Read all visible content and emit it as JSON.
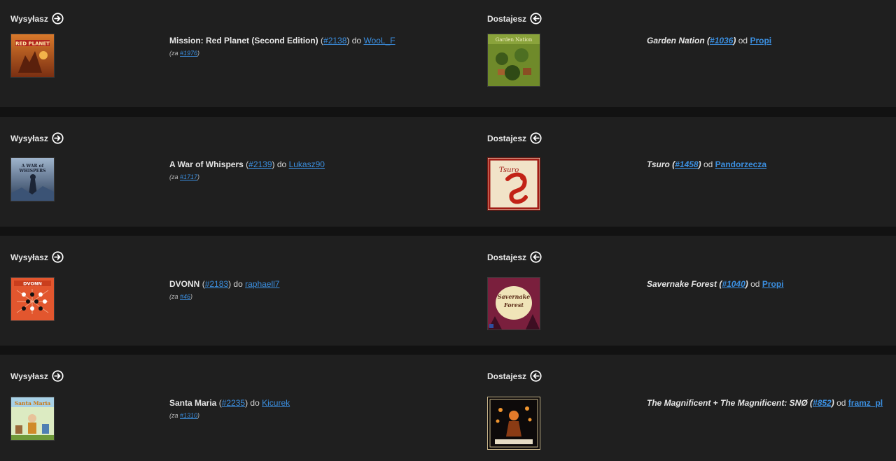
{
  "labels": {
    "send": "Wysyłasz",
    "receive": "Dostajesz",
    "to": "do",
    "from": "od",
    "za_prefix": "(za ",
    "za_suffix": ")"
  },
  "trades": [
    {
      "send": {
        "title": "Mission: Red Planet (Second Edition)",
        "id": "#2138",
        "user": "WooL_F",
        "za": "#1976"
      },
      "receive": {
        "title": "Garden Nation",
        "id": "#1036",
        "user": "Propi"
      }
    },
    {
      "send": {
        "title": "A War of Whispers",
        "id": "#2139",
        "user": "Lukasz90",
        "za": "#1717"
      },
      "receive": {
        "title": "Tsuro",
        "id": "#1458",
        "user": "Pandorzecza"
      }
    },
    {
      "send": {
        "title": "DVONN",
        "id": "#2183",
        "user": "raphaell7",
        "za": "#46"
      },
      "receive": {
        "title": "Savernake Forest",
        "id": "#1040",
        "user": "Propi"
      }
    },
    {
      "send": {
        "title": "Santa Maria",
        "id": "#2235",
        "user": "Kicurek",
        "za": "#1310"
      },
      "receive": {
        "title": "The Magnificent + The Magnificent: SNØ",
        "id": "#852",
        "user": "framz_pl"
      }
    }
  ],
  "colors": {
    "link": "#3b8fe0",
    "row_bg": "#1f1f1f",
    "separator": "#121212"
  }
}
